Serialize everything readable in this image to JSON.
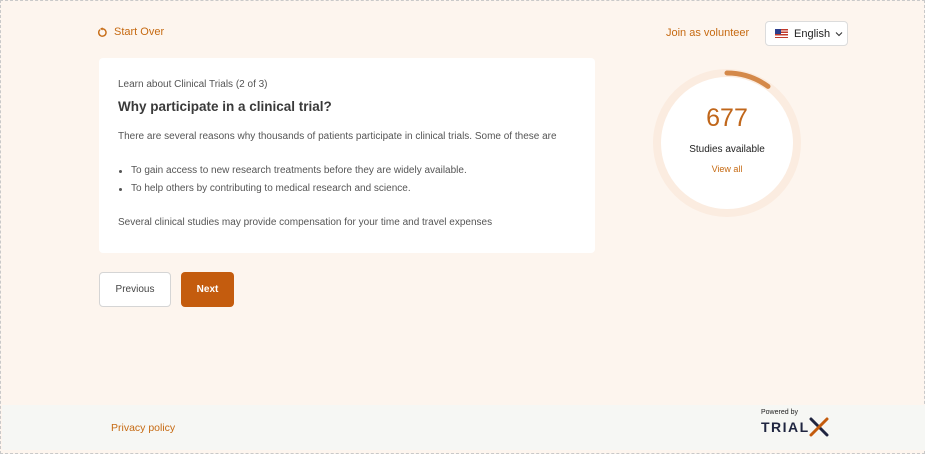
{
  "header": {
    "start_over": "Start Over",
    "join": "Join as volunteer",
    "language": "English"
  },
  "card": {
    "eyebrow": "Learn about Clinical Trials (2 of 3)",
    "heading": "Why participate in a clinical trial?",
    "intro": "There are several reasons why thousands of patients participate in clinical trials. Some of these are",
    "bullets": [
      "To gain access to new research treatments before they are widely available.",
      "To help others by contributing to medical research and science."
    ],
    "closing": "Several clinical studies may provide compensation for your time and travel expenses"
  },
  "nav": {
    "previous": "Previous",
    "next": "Next"
  },
  "studies": {
    "count": "677",
    "label": "Studies available",
    "view_all": "View all"
  },
  "footer": {
    "privacy": "Privacy policy",
    "powered_by": "Powered by",
    "logo_text": "TRIAL"
  },
  "colors": {
    "accent": "#c66a12",
    "next_button": "#c45c0e",
    "background": "#fdf5ee"
  },
  "icons": {
    "start_over": "restart-icon",
    "language_flag": "us-flag-icon",
    "language_chevron": "chevron-down-icon",
    "logo_mark": "x-logo-icon"
  }
}
